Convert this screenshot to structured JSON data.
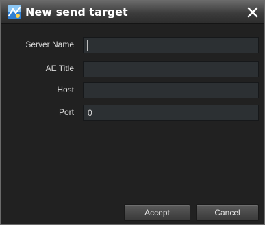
{
  "window": {
    "title": "New send target",
    "icon": "app-icon",
    "close_icon": "close-icon"
  },
  "form": {
    "server_name": {
      "label": "Server Name",
      "value": ""
    },
    "ae_title": {
      "label": "AE Title",
      "value": ""
    },
    "host": {
      "label": "Host",
      "value": ""
    },
    "port": {
      "label": "Port",
      "value": "0"
    }
  },
  "buttons": {
    "accept": "Accept",
    "cancel": "Cancel"
  },
  "colors": {
    "background": "#212121",
    "field": "#2c3033",
    "text": "#dcdcdc"
  }
}
